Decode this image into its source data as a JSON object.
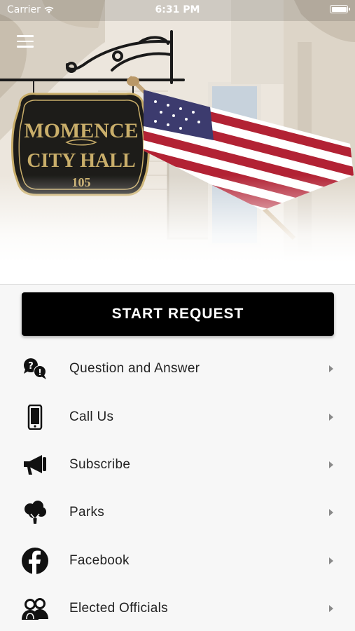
{
  "status_bar": {
    "carrier": "Carrier",
    "time": "6:31 PM"
  },
  "hero": {
    "sign_line1": "MOMENCE",
    "sign_line2": "CITY HALL",
    "sign_number": "105"
  },
  "start_button": {
    "label": "START REQUEST"
  },
  "menu": [
    {
      "label": "Question and Answer",
      "icon": "question-answer-icon"
    },
    {
      "label": "Call Us",
      "icon": "phone-icon"
    },
    {
      "label": "Subscribe",
      "icon": "megaphone-icon"
    },
    {
      "label": "Parks",
      "icon": "tree-icon"
    },
    {
      "label": "Facebook",
      "icon": "facebook-icon"
    },
    {
      "label": "Elected Officials",
      "icon": "officials-icon"
    }
  ],
  "colors": {
    "button_bg": "#000000",
    "button_text": "#ffffff",
    "sign_bg": "#1d1c19",
    "sign_gold": "#c9ae6a",
    "flag_red": "#b22234",
    "flag_blue": "#3c3b6e"
  }
}
